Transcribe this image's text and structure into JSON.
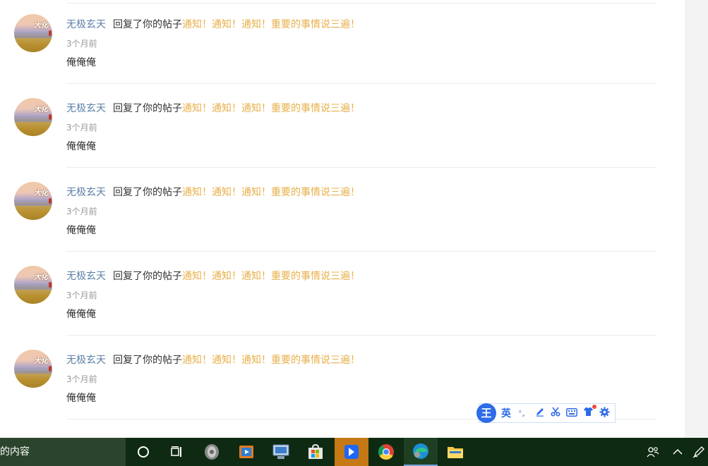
{
  "notifications": [
    {
      "user": "无极玄天",
      "action": "回复了你的帖子",
      "post_title": "通知！通知！通知！重要的事情说三遍！",
      "time": "3个月前",
      "content": "俺俺俺",
      "avatar_text": "大化"
    },
    {
      "user": "无极玄天",
      "action": "回复了你的帖子",
      "post_title": "通知！通知！通知！重要的事情说三遍！",
      "time": "3个月前",
      "content": "俺俺俺",
      "avatar_text": "大化"
    },
    {
      "user": "无极玄天",
      "action": "回复了你的帖子",
      "post_title": "通知！通知！通知！重要的事情说三遍！",
      "time": "3个月前",
      "content": "俺俺俺",
      "avatar_text": "大化"
    },
    {
      "user": "无极玄天",
      "action": "回复了你的帖子",
      "post_title": "通知！通知！通知！重要的事情说三遍！",
      "time": "3个月前",
      "content": "俺俺俺",
      "avatar_text": "大化"
    },
    {
      "user": "无极玄天",
      "action": "回复了你的帖子",
      "post_title": "通知！通知！通知！重要的事情说三遍！",
      "time": "3个月前",
      "content": "俺俺俺",
      "avatar_text": "大化"
    }
  ],
  "ime": {
    "logo": "王",
    "mode": "英",
    "punct": "°,",
    "icons": [
      "pen-icon",
      "scissors-icon",
      "keyboard-icon",
      "shirt-icon",
      "gear-icon"
    ]
  },
  "taskbar": {
    "search_text": "的内容",
    "apps": [
      "cortana-icon",
      "task-view-icon",
      "media-player-icon",
      "video-app-icon",
      "remote-desktop-icon",
      "store-icon",
      "feishu-icon",
      "chrome-icon",
      "edge-icon",
      "file-explorer-icon"
    ]
  },
  "colors": {
    "user_link": "#5b7fa6",
    "post_link": "#e8b04a",
    "taskbar": "#0f2a12",
    "ime_accent": "#2e6be6"
  }
}
